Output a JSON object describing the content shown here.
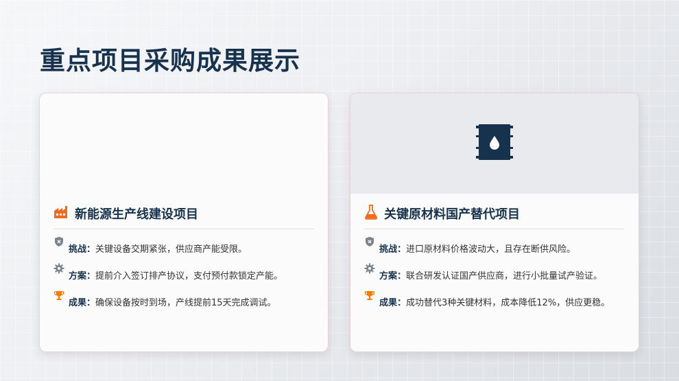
{
  "page": {
    "title": "重点项目采购成果展示"
  },
  "colors": {
    "title": "#17324d",
    "accent": "#f26b1d",
    "icon_gray": "#7c848c",
    "trophy": "#f57c00"
  },
  "cards": [
    {
      "title": "新能源生产线建设项目",
      "header_icon": "factory-icon",
      "media_icon": "",
      "rows": [
        {
          "icon": "shield-icon",
          "label": "挑战：",
          "text": "关键设备交期紧张，供应商产能受限。"
        },
        {
          "icon": "gear-icon",
          "label": "方案：",
          "text": "提前介入签订排产协议，支付预付款锁定产能。"
        },
        {
          "icon": "trophy-icon",
          "label": "成果：",
          "text": "确保设备按时到场，产线提前15天完成调试。"
        }
      ]
    },
    {
      "title": "关键原材料国产替代项目",
      "header_icon": "flask-icon",
      "media_icon": "oil-barrel-icon",
      "rows": [
        {
          "icon": "shield-icon",
          "label": "挑战：",
          "text": "进口原材料价格波动大，且存在断供风险。"
        },
        {
          "icon": "gear-icon",
          "label": "方案：",
          "text": "联合研发认证国产供应商，进行小批量试产验证。"
        },
        {
          "icon": "trophy-icon",
          "label": "成果：",
          "text": "成功替代3种关键材料，成本降低12%，供应更稳。"
        }
      ]
    }
  ]
}
